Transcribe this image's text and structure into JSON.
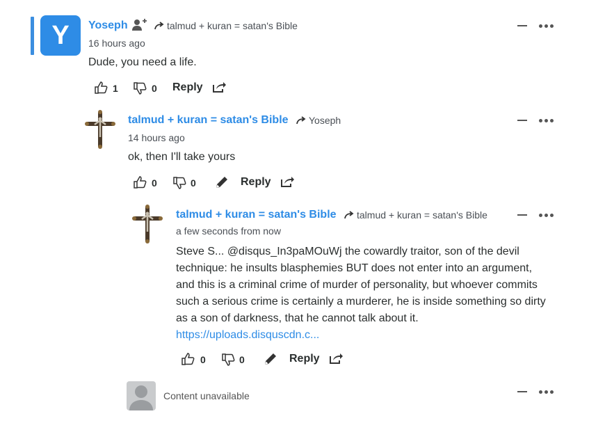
{
  "comments": [
    {
      "avatar_letter": "Y",
      "author": "Yoseph",
      "reply_to": "talmud + kuran = satan's Bible",
      "time": "16 hours ago",
      "text": "Dude, you need a life.",
      "upvotes": "1",
      "downvotes": "0",
      "reply_label": "Reply"
    },
    {
      "author": "talmud + kuran = satan's Bible",
      "reply_to": "Yoseph",
      "time": "14 hours ago",
      "text": "ok, then I'll take yours",
      "upvotes": "0",
      "downvotes": "0",
      "reply_label": "Reply"
    },
    {
      "author": "talmud + kuran = satan's Bible",
      "reply_to": "talmud + kuran = satan's Bible",
      "time": "a few seconds from now",
      "text_lines": [
        "Steve S... @disqus_In3paMOuWj the cowardly traitor, son of the devil",
        "technique: he insults blasphemies BUT does not enter into an argument,",
        "and this is a criminal crime of murder of personality, but whoever commits",
        "such a serious crime is certainly a murderer, he is inside something so dirty",
        "as a son of darkness, that he cannot talk about it."
      ],
      "link": "https://uploads.disquscdn.c...",
      "upvotes": "0",
      "downvotes": "0",
      "reply_label": "Reply"
    }
  ],
  "unavailable_text": "Content unavailable",
  "colors": {
    "accent": "#2e8ce6",
    "thread_bar": "#3b8ee0",
    "text": "#2a2e2e"
  },
  "icons": [
    "follow-user-icon",
    "reply-arrow-icon",
    "thumbs-up-icon",
    "thumbs-down-icon",
    "pencil-icon",
    "share-icon",
    "collapse-icon",
    "more-options-icon",
    "crucifix-avatar"
  ]
}
